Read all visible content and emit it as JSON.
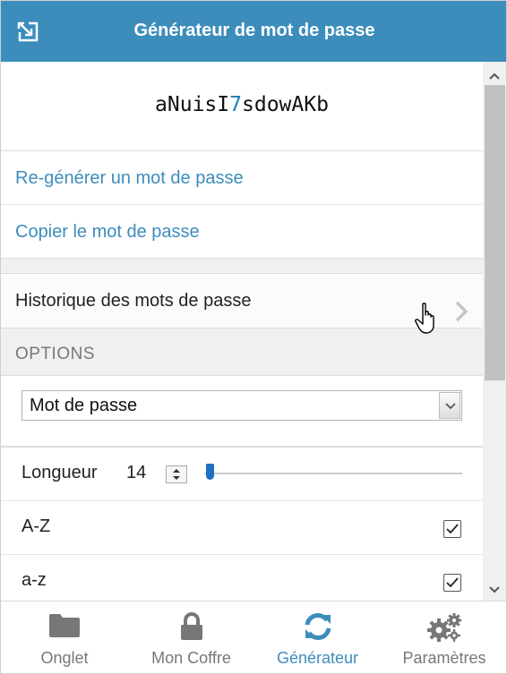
{
  "header": {
    "title": "Générateur de mot de passe",
    "popout_icon": "popout-icon"
  },
  "generator": {
    "password_before": "aNuisI",
    "password_digit": "7",
    "password_after": "sdowAKb",
    "regenerate_label": "Re-générer un mot de passe",
    "copy_label": "Copier le mot de passe",
    "history_label": "Historique des mots de passe"
  },
  "options": {
    "section_label": "OPTIONS",
    "type_selected": "Mot de passe",
    "length_label": "Longueur",
    "length_value": "14",
    "length_fraction": 0.0,
    "uppercase_label": "A-Z",
    "uppercase_checked": true,
    "lowercase_label": "a-z",
    "lowercase_checked": true
  },
  "tabs": [
    {
      "label": "Onglet",
      "icon": "folder-icon",
      "active": false
    },
    {
      "label": "Mon Coffre",
      "icon": "lock-icon",
      "active": false
    },
    {
      "label": "Générateur",
      "icon": "refresh-icon",
      "active": true
    },
    {
      "label": "Paramètres",
      "icon": "gears-icon",
      "active": false
    }
  ],
  "colors": {
    "accent": "#3c8dbc",
    "password_digit": "#1d7dbd",
    "slider_thumb": "#1d6fc2",
    "inactive_tab": "#777777"
  }
}
